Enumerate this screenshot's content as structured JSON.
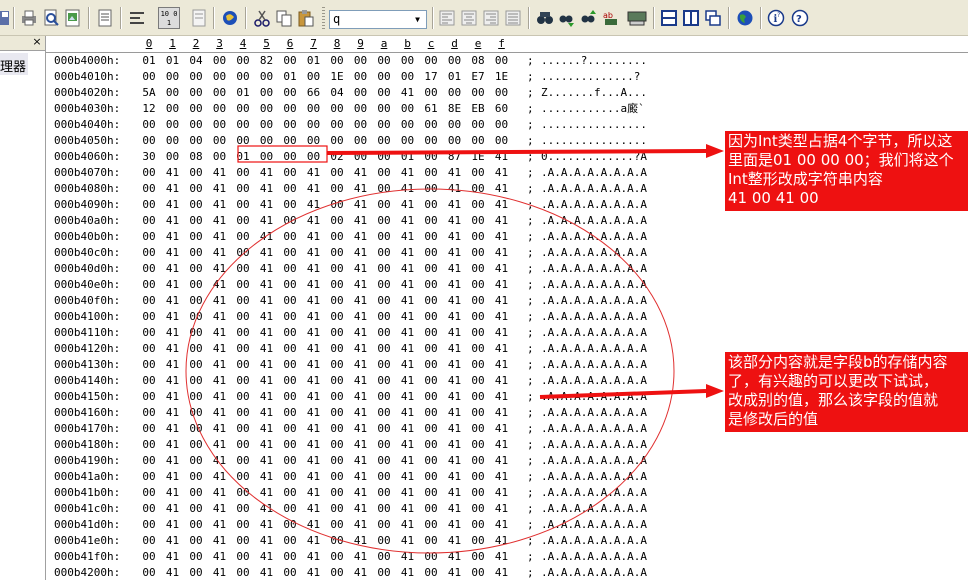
{
  "toolbar": {
    "search_value": "q",
    "icons": [
      "save-icon",
      "print-icon",
      "print-preview-icon",
      "export-icon",
      "document-icon",
      "wrap-icon",
      "hex-mode-icon",
      "properties-icon",
      "web-icon",
      "cut-icon",
      "copy-icon",
      "paste-icon",
      "align-left-icon",
      "align-center-icon",
      "align-right-icon",
      "justify-icon",
      "find-icon",
      "find-next-icon",
      "find-prev-icon",
      "replace-icon",
      "goto-icon",
      "split-horizontal-icon",
      "split-vertical-icon",
      "cascade-icon",
      "globe-icon",
      "help-icon",
      "about-icon"
    ],
    "hex_mode_label": "10 01"
  },
  "left_panel": {
    "item_label": "理器",
    "close_label": "×"
  },
  "ruler": {
    "columns": [
      "0",
      "1",
      "2",
      "3",
      "4",
      "5",
      "6",
      "7",
      "8",
      "9",
      "a",
      "b",
      "c",
      "d",
      "e",
      "f"
    ]
  },
  "hex": {
    "rows": [
      {
        "addr": "000b4000h:",
        "bytes": [
          "01",
          "01",
          "04",
          "00",
          "00",
          "82",
          "00",
          "01",
          "00",
          "00",
          "00",
          "00",
          "00",
          "00",
          "08",
          "00"
        ],
        "ascii": "......?........."
      },
      {
        "addr": "000b4010h:",
        "bytes": [
          "00",
          "00",
          "00",
          "00",
          "00",
          "00",
          "01",
          "00",
          "1E",
          "00",
          "00",
          "00",
          "17",
          "01",
          "E7",
          "1E"
        ],
        "ascii": "..............?"
      },
      {
        "addr": "000b4020h:",
        "bytes": [
          "5A",
          "00",
          "00",
          "00",
          "01",
          "00",
          "00",
          "66",
          "04",
          "00",
          "00",
          "41",
          "00",
          "00",
          "00",
          "00"
        ],
        "ascii": "Z.......f...A..."
      },
      {
        "addr": "000b4030h:",
        "bytes": [
          "12",
          "00",
          "00",
          "00",
          "00",
          "00",
          "00",
          "00",
          "00",
          "00",
          "00",
          "00",
          "61",
          "8E",
          "EB",
          "60"
        ],
        "ascii": "............a廄`"
      },
      {
        "addr": "000b4040h:",
        "bytes": [
          "00",
          "00",
          "00",
          "00",
          "00",
          "00",
          "00",
          "00",
          "00",
          "00",
          "00",
          "00",
          "00",
          "00",
          "00",
          "00"
        ],
        "ascii": "................"
      },
      {
        "addr": "000b4050h:",
        "bytes": [
          "00",
          "00",
          "00",
          "00",
          "00",
          "00",
          "00",
          "00",
          "00",
          "00",
          "00",
          "00",
          "00",
          "00",
          "00",
          "00"
        ],
        "ascii": "................"
      },
      {
        "addr": "000b4060h:",
        "bytes": [
          "30",
          "00",
          "08",
          "00",
          "01",
          "00",
          "00",
          "00",
          "02",
          "00",
          "00",
          "01",
          "00",
          "87",
          "1E",
          "41"
        ],
        "ascii": "0.............?A"
      },
      {
        "addr": "000b4070h:",
        "bytes": [
          "00",
          "41",
          "00",
          "41",
          "00",
          "41",
          "00",
          "41",
          "00",
          "41",
          "00",
          "41",
          "00",
          "41",
          "00",
          "41"
        ],
        "ascii": ".A.A.A.A.A.A.A.A"
      },
      {
        "addr": "000b4080h:",
        "bytes": [
          "00",
          "41",
          "00",
          "41",
          "00",
          "41",
          "00",
          "41",
          "00",
          "41",
          "00",
          "41",
          "00",
          "41",
          "00",
          "41"
        ],
        "ascii": ".A.A.A.A.A.A.A.A"
      },
      {
        "addr": "000b4090h:",
        "bytes": [
          "00",
          "41",
          "00",
          "41",
          "00",
          "41",
          "00",
          "41",
          "00",
          "41",
          "00",
          "41",
          "00",
          "41",
          "00",
          "41"
        ],
        "ascii": ".A.A.A.A.A.A.A.A"
      },
      {
        "addr": "000b40a0h:",
        "bytes": [
          "00",
          "41",
          "00",
          "41",
          "00",
          "41",
          "00",
          "41",
          "00",
          "41",
          "00",
          "41",
          "00",
          "41",
          "00",
          "41"
        ],
        "ascii": ".A.A.A.A.A.A.A.A"
      },
      {
        "addr": "000b40b0h:",
        "bytes": [
          "00",
          "41",
          "00",
          "41",
          "00",
          "41",
          "00",
          "41",
          "00",
          "41",
          "00",
          "41",
          "00",
          "41",
          "00",
          "41"
        ],
        "ascii": ".A.A.A.A.A.A.A.A"
      },
      {
        "addr": "000b40c0h:",
        "bytes": [
          "00",
          "41",
          "00",
          "41",
          "00",
          "41",
          "00",
          "41",
          "00",
          "41",
          "00",
          "41",
          "00",
          "41",
          "00",
          "41"
        ],
        "ascii": ".A.A.A.A.A.A.A.A"
      },
      {
        "addr": "000b40d0h:",
        "bytes": [
          "00",
          "41",
          "00",
          "41",
          "00",
          "41",
          "00",
          "41",
          "00",
          "41",
          "00",
          "41",
          "00",
          "41",
          "00",
          "41"
        ],
        "ascii": ".A.A.A.A.A.A.A.A"
      },
      {
        "addr": "000b40e0h:",
        "bytes": [
          "00",
          "41",
          "00",
          "41",
          "00",
          "41",
          "00",
          "41",
          "00",
          "41",
          "00",
          "41",
          "00",
          "41",
          "00",
          "41"
        ],
        "ascii": ".A.A.A.A.A.A.A.A"
      },
      {
        "addr": "000b40f0h:",
        "bytes": [
          "00",
          "41",
          "00",
          "41",
          "00",
          "41",
          "00",
          "41",
          "00",
          "41",
          "00",
          "41",
          "00",
          "41",
          "00",
          "41"
        ],
        "ascii": ".A.A.A.A.A.A.A.A"
      },
      {
        "addr": "000b4100h:",
        "bytes": [
          "00",
          "41",
          "00",
          "41",
          "00",
          "41",
          "00",
          "41",
          "00",
          "41",
          "00",
          "41",
          "00",
          "41",
          "00",
          "41"
        ],
        "ascii": ".A.A.A.A.A.A.A.A"
      },
      {
        "addr": "000b4110h:",
        "bytes": [
          "00",
          "41",
          "00",
          "41",
          "00",
          "41",
          "00",
          "41",
          "00",
          "41",
          "00",
          "41",
          "00",
          "41",
          "00",
          "41"
        ],
        "ascii": ".A.A.A.A.A.A.A.A"
      },
      {
        "addr": "000b4120h:",
        "bytes": [
          "00",
          "41",
          "00",
          "41",
          "00",
          "41",
          "00",
          "41",
          "00",
          "41",
          "00",
          "41",
          "00",
          "41",
          "00",
          "41"
        ],
        "ascii": ".A.A.A.A.A.A.A.A"
      },
      {
        "addr": "000b4130h:",
        "bytes": [
          "00",
          "41",
          "00",
          "41",
          "00",
          "41",
          "00",
          "41",
          "00",
          "41",
          "00",
          "41",
          "00",
          "41",
          "00",
          "41"
        ],
        "ascii": ".A.A.A.A.A.A.A.A"
      },
      {
        "addr": "000b4140h:",
        "bytes": [
          "00",
          "41",
          "00",
          "41",
          "00",
          "41",
          "00",
          "41",
          "00",
          "41",
          "00",
          "41",
          "00",
          "41",
          "00",
          "41"
        ],
        "ascii": ".A.A.A.A.A.A.A.A"
      },
      {
        "addr": "000b4150h:",
        "bytes": [
          "00",
          "41",
          "00",
          "41",
          "00",
          "41",
          "00",
          "41",
          "00",
          "41",
          "00",
          "41",
          "00",
          "41",
          "00",
          "41"
        ],
        "ascii": ".A.A.A.A.A.A.A.A"
      },
      {
        "addr": "000b4160h:",
        "bytes": [
          "00",
          "41",
          "00",
          "41",
          "00",
          "41",
          "00",
          "41",
          "00",
          "41",
          "00",
          "41",
          "00",
          "41",
          "00",
          "41"
        ],
        "ascii": ".A.A.A.A.A.A.A.A"
      },
      {
        "addr": "000b4170h:",
        "bytes": [
          "00",
          "41",
          "00",
          "41",
          "00",
          "41",
          "00",
          "41",
          "00",
          "41",
          "00",
          "41",
          "00",
          "41",
          "00",
          "41"
        ],
        "ascii": ".A.A.A.A.A.A.A.A"
      },
      {
        "addr": "000b4180h:",
        "bytes": [
          "00",
          "41",
          "00",
          "41",
          "00",
          "41",
          "00",
          "41",
          "00",
          "41",
          "00",
          "41",
          "00",
          "41",
          "00",
          "41"
        ],
        "ascii": ".A.A.A.A.A.A.A.A"
      },
      {
        "addr": "000b4190h:",
        "bytes": [
          "00",
          "41",
          "00",
          "41",
          "00",
          "41",
          "00",
          "41",
          "00",
          "41",
          "00",
          "41",
          "00",
          "41",
          "00",
          "41"
        ],
        "ascii": ".A.A.A.A.A.A.A.A"
      },
      {
        "addr": "000b41a0h:",
        "bytes": [
          "00",
          "41",
          "00",
          "41",
          "00",
          "41",
          "00",
          "41",
          "00",
          "41",
          "00",
          "41",
          "00",
          "41",
          "00",
          "41"
        ],
        "ascii": ".A.A.A.A.A.A.A.A"
      },
      {
        "addr": "000b41b0h:",
        "bytes": [
          "00",
          "41",
          "00",
          "41",
          "00",
          "41",
          "00",
          "41",
          "00",
          "41",
          "00",
          "41",
          "00",
          "41",
          "00",
          "41"
        ],
        "ascii": ".A.A.A.A.A.A.A.A"
      },
      {
        "addr": "000b41c0h:",
        "bytes": [
          "00",
          "41",
          "00",
          "41",
          "00",
          "41",
          "00",
          "41",
          "00",
          "41",
          "00",
          "41",
          "00",
          "41",
          "00",
          "41"
        ],
        "ascii": ".A.A.A.A.A.A.A.A"
      },
      {
        "addr": "000b41d0h:",
        "bytes": [
          "00",
          "41",
          "00",
          "41",
          "00",
          "41",
          "00",
          "41",
          "00",
          "41",
          "00",
          "41",
          "00",
          "41",
          "00",
          "41"
        ],
        "ascii": ".A.A.A.A.A.A.A.A"
      },
      {
        "addr": "000b41e0h:",
        "bytes": [
          "00",
          "41",
          "00",
          "41",
          "00",
          "41",
          "00",
          "41",
          "00",
          "41",
          "00",
          "41",
          "00",
          "41",
          "00",
          "41"
        ],
        "ascii": ".A.A.A.A.A.A.A.A"
      },
      {
        "addr": "000b41f0h:",
        "bytes": [
          "00",
          "41",
          "00",
          "41",
          "00",
          "41",
          "00",
          "41",
          "00",
          "41",
          "00",
          "41",
          "00",
          "41",
          "00",
          "41"
        ],
        "ascii": ".A.A.A.A.A.A.A.A"
      },
      {
        "addr": "000b4200h:",
        "bytes": [
          "00",
          "41",
          "00",
          "41",
          "00",
          "41",
          "00",
          "41",
          "00",
          "41",
          "00",
          "41",
          "00",
          "41",
          "00",
          "41"
        ],
        "ascii": ".A.A.A.A.A.A.A.A"
      }
    ]
  },
  "annotations": {
    "top": {
      "lines": [
        "因为Int类型占据4个字节，所以这",
        "里面是01 00 00 00；我们将这个",
        "Int整形改成字符串内容",
        "41 00 41 00"
      ]
    },
    "bottom": {
      "lines": [
        "该部分内容就是字段b的存储内容",
        "了，有兴趣的可以更改下试试，",
        "改成别的值，那么该字段的值就",
        "是修改后的值"
      ]
    }
  },
  "colors": {
    "annotation_bg": "#ee1111",
    "toolbar_bg": "#ece9d8",
    "highlight": "#ee1111"
  }
}
